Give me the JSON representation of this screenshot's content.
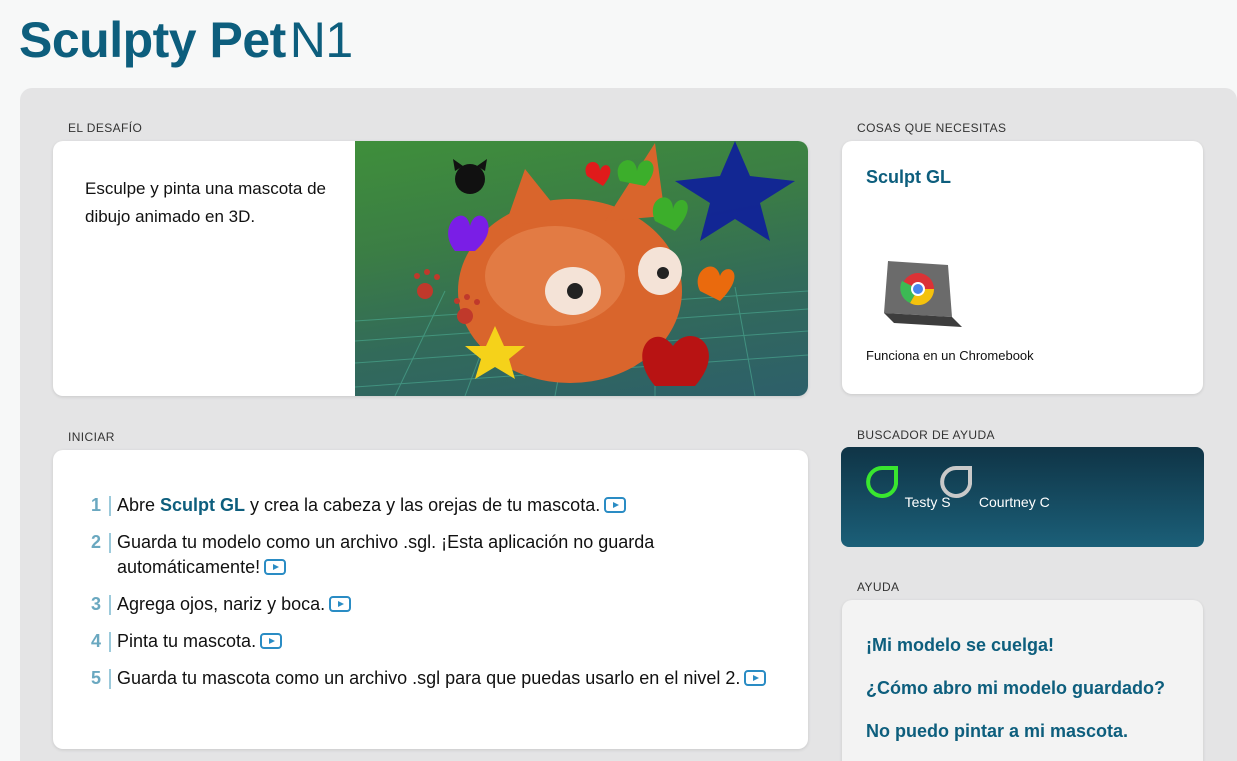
{
  "header": {
    "title_bold": "Sculpty Pet",
    "title_level": "N1"
  },
  "challenge": {
    "label": "EL DESAFÍO",
    "text": "Esculpe y pinta una mascota de dibujo animado en 3D."
  },
  "things": {
    "label": "COSAS QUE NECESITAS",
    "tool": "Sculpt GL",
    "device_caption": "Funciona en un Chromebook",
    "device_icon": "chromebook-icon"
  },
  "start": {
    "label": "INICIAR",
    "steps": [
      {
        "num": "1",
        "before": "Abre ",
        "link": "Sculpt GL",
        "after": " y crea la cabeza y las orejas de tu mascota."
      },
      {
        "num": "2",
        "before": "Guarda tu modelo como un archivo .sgl. ¡Esta aplicación no guarda automáticamente!",
        "link": "",
        "after": ""
      },
      {
        "num": "3",
        "before": "Agrega ojos, nariz y boca.",
        "link": "",
        "after": ""
      },
      {
        "num": "4",
        "before": "Pinta tu mascota.",
        "link": "",
        "after": ""
      },
      {
        "num": "5",
        "before": "Guarda tu mascota como un archivo .sgl para que puedas usarlo en el nivel 2.",
        "link": "",
        "after": ""
      }
    ],
    "video_icon": "play-video-icon"
  },
  "help_finder": {
    "label": "BUSCADOR DE AYUDA",
    "helpers": [
      {
        "name": "Testy S",
        "color": "#39e62f"
      },
      {
        "name": "Courtney C",
        "color": "#c9c9c9"
      }
    ]
  },
  "help": {
    "label": "AYUDA",
    "links": [
      "¡Mi modelo se cuelga!",
      "¿Cómo abro mi modelo guardado?",
      "No puedo pintar a mi mascota."
    ]
  },
  "colors": {
    "brand": "#0d5e7d",
    "panel": "#e4e4e5",
    "accent": "#2a8cc4"
  }
}
